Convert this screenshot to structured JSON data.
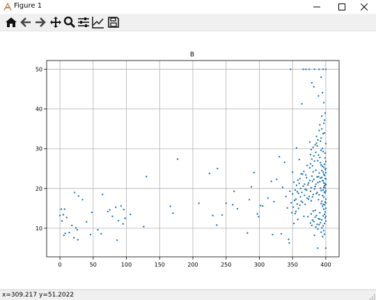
{
  "window": {
    "title": "Figure 1"
  },
  "toolbar": {
    "items": [
      {
        "name": "home-icon",
        "label": "Home"
      },
      {
        "name": "back-icon",
        "label": "Back"
      },
      {
        "name": "forward-icon",
        "label": "Forward"
      },
      {
        "name": "pan-icon",
        "label": "Pan"
      },
      {
        "name": "zoom-icon",
        "label": "Zoom"
      },
      {
        "name": "subplots-icon",
        "label": "Subplots"
      },
      {
        "name": "edit-axis-icon",
        "label": "Customize"
      },
      {
        "name": "save-icon",
        "label": "Save"
      }
    ]
  },
  "status": {
    "x_text": "x=309.217",
    "y_text": "y=51.2022"
  },
  "colors": {
    "marker": "#1f77b4",
    "grid": "#b0b0b0",
    "axis": "#000000"
  },
  "chart_data": {
    "type": "scatter",
    "title": "B",
    "xlabel": "",
    "ylabel": "",
    "xlim": [
      -20,
      420
    ],
    "ylim": [
      2.8,
      52.2
    ],
    "grid": true,
    "xticks": [
      0,
      50,
      100,
      150,
      200,
      250,
      300,
      350,
      400
    ],
    "yticks": [
      10,
      20,
      30,
      40,
      50
    ],
    "points": [
      [
        0,
        13.2
      ],
      [
        2,
        14.8
      ],
      [
        3,
        11.8
      ],
      [
        5,
        13.4
      ],
      [
        6,
        8.2
      ],
      [
        7,
        14.8
      ],
      [
        8,
        8.7
      ],
      [
        10,
        12.7
      ],
      [
        14,
        8.9
      ],
      [
        18,
        10.7
      ],
      [
        21,
        7.6
      ],
      [
        22,
        19.0
      ],
      [
        24,
        10.1
      ],
      [
        26,
        9.6
      ],
      [
        27,
        7.1
      ],
      [
        28,
        18.1
      ],
      [
        34,
        17.2
      ],
      [
        40,
        11.6
      ],
      [
        46,
        8.4
      ],
      [
        48,
        14.0
      ],
      [
        57,
        9.6
      ],
      [
        62,
        8.6
      ],
      [
        64,
        18.5
      ],
      [
        72,
        14.2
      ],
      [
        75,
        14.6
      ],
      [
        79,
        13.0
      ],
      [
        84,
        15.3
      ],
      [
        86,
        7.0
      ],
      [
        88,
        11.9
      ],
      [
        92,
        15.6
      ],
      [
        95,
        11.1
      ],
      [
        96,
        14.7
      ],
      [
        98,
        12.5
      ],
      [
        106,
        13.5
      ],
      [
        126,
        10.4
      ],
      [
        130,
        23.0
      ],
      [
        166,
        15.5
      ],
      [
        170,
        13.8
      ],
      [
        177,
        27.4
      ],
      [
        209,
        16.3
      ],
      [
        225,
        23.8
      ],
      [
        230,
        13.2
      ],
      [
        236,
        10.8
      ],
      [
        237,
        25.0
      ],
      [
        244,
        13.3
      ],
      [
        250,
        16.3
      ],
      [
        260,
        15.9
      ],
      [
        262,
        19.3
      ],
      [
        267,
        14.9
      ],
      [
        282,
        8.8
      ],
      [
        285,
        17.2
      ],
      [
        288,
        20.4
      ],
      [
        292,
        24.0
      ],
      [
        297,
        13.6
      ],
      [
        299,
        12.9
      ],
      [
        302,
        15.7
      ],
      [
        305,
        15.6
      ],
      [
        313,
        17.6
      ],
      [
        318,
        21.8
      ],
      [
        320,
        8.4
      ],
      [
        322,
        16.7
      ],
      [
        326,
        22.3
      ],
      [
        330,
        28.0
      ],
      [
        333,
        8.6
      ],
      [
        335,
        20.3
      ],
      [
        338,
        26.6
      ],
      [
        340,
        18.0
      ],
      [
        342,
        15.1
      ],
      [
        344,
        7.2
      ],
      [
        345,
        6.3
      ],
      [
        346,
        19.3
      ],
      [
        347,
        50.0
      ],
      [
        348,
        16.4
      ],
      [
        350,
        24.1
      ],
      [
        352,
        11.2
      ],
      [
        354,
        13.7
      ],
      [
        355,
        17.3
      ],
      [
        356,
        30.2
      ],
      [
        357,
        19.2
      ],
      [
        358,
        12.2
      ],
      [
        359,
        15.0
      ],
      [
        360,
        27.3
      ],
      [
        361,
        22.5
      ],
      [
        362,
        20.0
      ],
      [
        363,
        16.8
      ],
      [
        364,
        41.3
      ],
      [
        365,
        23.6
      ],
      [
        366,
        50.0
      ],
      [
        367,
        13.0
      ],
      [
        368,
        21.1
      ],
      [
        369,
        16.0
      ],
      [
        370,
        50.0
      ],
      [
        371,
        19.6
      ],
      [
        372,
        25.8
      ],
      [
        373,
        12.9
      ],
      [
        374,
        17.3
      ],
      [
        375,
        50.0
      ],
      [
        376,
        22.0
      ],
      [
        377,
        28.5
      ],
      [
        378,
        20.2
      ],
      [
        379,
        46.6
      ],
      [
        380,
        17.9
      ],
      [
        381,
        24.2
      ],
      [
        382,
        45.6
      ],
      [
        383,
        50.0
      ],
      [
        384,
        14.5
      ],
      [
        385,
        21.1
      ],
      [
        386,
        31.4
      ],
      [
        387,
        19.0
      ],
      [
        388,
        27.0
      ],
      [
        388,
        5.0
      ],
      [
        389,
        23.0
      ],
      [
        389,
        43.3
      ],
      [
        390,
        18.4
      ],
      [
        390,
        50.0
      ],
      [
        391,
        36.0
      ],
      [
        391,
        12.3
      ],
      [
        392,
        26.5
      ],
      [
        392,
        20.1
      ],
      [
        393,
        48.0
      ],
      [
        393,
        16.2
      ],
      [
        393,
        32.7
      ],
      [
        394,
        24.5
      ],
      [
        394,
        10.1
      ],
      [
        394,
        38.2
      ],
      [
        395,
        44.1
      ],
      [
        395,
        22.0
      ],
      [
        395,
        15.5
      ],
      [
        396,
        50.0
      ],
      [
        396,
        29.3
      ],
      [
        396,
        19.6
      ],
      [
        396,
        13.1
      ],
      [
        397,
        41.6
      ],
      [
        397,
        25.3
      ],
      [
        397,
        21.4
      ],
      [
        397,
        17.8
      ],
      [
        398,
        34.0
      ],
      [
        398,
        23.3
      ],
      [
        398,
        20.7
      ],
      [
        398,
        11.2
      ],
      [
        398,
        8.5
      ],
      [
        399,
        39.0
      ],
      [
        399,
        27.7
      ],
      [
        399,
        24.8
      ],
      [
        399,
        22.5
      ],
      [
        399,
        18.9
      ],
      [
        399,
        14.1
      ],
      [
        400,
        31.3
      ],
      [
        400,
        21.0
      ],
      [
        400,
        5.0
      ],
      [
        400,
        50.0
      ],
      [
        400,
        16.4
      ],
      [
        396,
        21.9
      ],
      [
        397,
        20.3
      ],
      [
        398,
        19.1
      ],
      [
        399,
        21.2
      ],
      [
        394,
        22.8
      ],
      [
        395,
        18.2
      ],
      [
        396,
        24.1
      ],
      [
        397,
        23.6
      ],
      [
        398,
        26.1
      ],
      [
        399,
        20.1
      ],
      [
        400,
        22.4
      ],
      [
        393,
        19.5
      ],
      [
        392,
        22.6
      ],
      [
        391,
        21.7
      ],
      [
        390,
        23.9
      ],
      [
        389,
        17.2
      ],
      [
        388,
        21.5
      ],
      [
        387,
        22.9
      ],
      [
        386,
        18.7
      ],
      [
        385,
        24.6
      ],
      [
        384,
        20.5
      ],
      [
        383,
        19.9
      ],
      [
        382,
        22.3
      ],
      [
        381,
        18.5
      ],
      [
        380,
        21.8
      ],
      [
        379,
        23.1
      ],
      [
        378,
        16.9
      ],
      [
        377,
        19.3
      ],
      [
        376,
        25.2
      ],
      [
        375,
        18.0
      ],
      [
        374,
        21.4
      ],
      [
        373,
        20.9
      ],
      [
        372,
        17.6
      ],
      [
        371,
        22.7
      ],
      [
        370,
        23.4
      ],
      [
        369,
        19.8
      ],
      [
        368,
        18.3
      ],
      [
        367,
        24.3
      ],
      [
        366,
        20.6
      ],
      [
        365,
        16.5
      ],
      [
        364,
        19.0
      ],
      [
        363,
        23.7
      ],
      [
        362,
        17.9
      ],
      [
        361,
        15.8
      ],
      [
        360,
        21.3
      ],
      [
        359,
        18.8
      ],
      [
        358,
        22.1
      ],
      [
        357,
        16.1
      ],
      [
        356,
        20.8
      ],
      [
        355,
        14.2
      ],
      [
        354,
        19.6
      ],
      [
        353,
        17.0
      ],
      [
        352,
        21.6
      ],
      [
        351,
        15.3
      ],
      [
        350,
        18.6
      ],
      [
        349,
        13.9
      ],
      [
        396,
        33.8
      ],
      [
        397,
        36.4
      ],
      [
        398,
        37.2
      ],
      [
        399,
        28.9
      ],
      [
        400,
        26.8
      ],
      [
        395,
        30.1
      ],
      [
        394,
        35.0
      ],
      [
        393,
        29.6
      ],
      [
        392,
        31.9
      ],
      [
        391,
        27.8
      ],
      [
        390,
        34.6
      ],
      [
        389,
        28.4
      ],
      [
        388,
        32.2
      ],
      [
        387,
        30.7
      ],
      [
        386,
        33.1
      ],
      [
        385,
        29.1
      ],
      [
        384,
        31.0
      ],
      [
        383,
        26.9
      ],
      [
        382,
        28.2
      ],
      [
        381,
        30.4
      ],
      [
        380,
        25.7
      ],
      [
        379,
        27.4
      ],
      [
        378,
        29.8
      ],
      [
        377,
        26.2
      ],
      [
        376,
        31.7
      ],
      [
        400,
        11.8
      ],
      [
        399,
        12.6
      ],
      [
        398,
        13.5
      ],
      [
        397,
        9.4
      ],
      [
        396,
        10.6
      ],
      [
        395,
        7.9
      ],
      [
        394,
        12.1
      ],
      [
        393,
        9.0
      ],
      [
        392,
        11.4
      ],
      [
        391,
        13.9
      ],
      [
        390,
        10.9
      ],
      [
        389,
        12.4
      ],
      [
        388,
        9.8
      ],
      [
        387,
        11.0
      ],
      [
        386,
        13.2
      ],
      [
        385,
        10.3
      ],
      [
        384,
        12.8
      ],
      [
        383,
        8.2
      ],
      [
        382,
        11.7
      ],
      [
        381,
        14.3
      ],
      [
        380,
        12.0
      ],
      [
        379,
        10.7
      ],
      [
        378,
        13.6
      ],
      [
        377,
        11.3
      ],
      [
        400,
        19.4
      ],
      [
        400,
        24.0
      ],
      [
        400,
        17.3
      ],
      [
        400,
        13.0
      ],
      [
        400,
        15.0
      ],
      [
        400,
        25.0
      ],
      [
        400,
        20.9
      ],
      [
        399,
        16.6
      ],
      [
        398,
        15.9
      ],
      [
        397,
        14.8
      ],
      [
        396,
        16.0
      ],
      [
        395,
        25.6
      ],
      [
        394,
        16.8
      ],
      [
        393,
        25.9
      ]
    ]
  }
}
